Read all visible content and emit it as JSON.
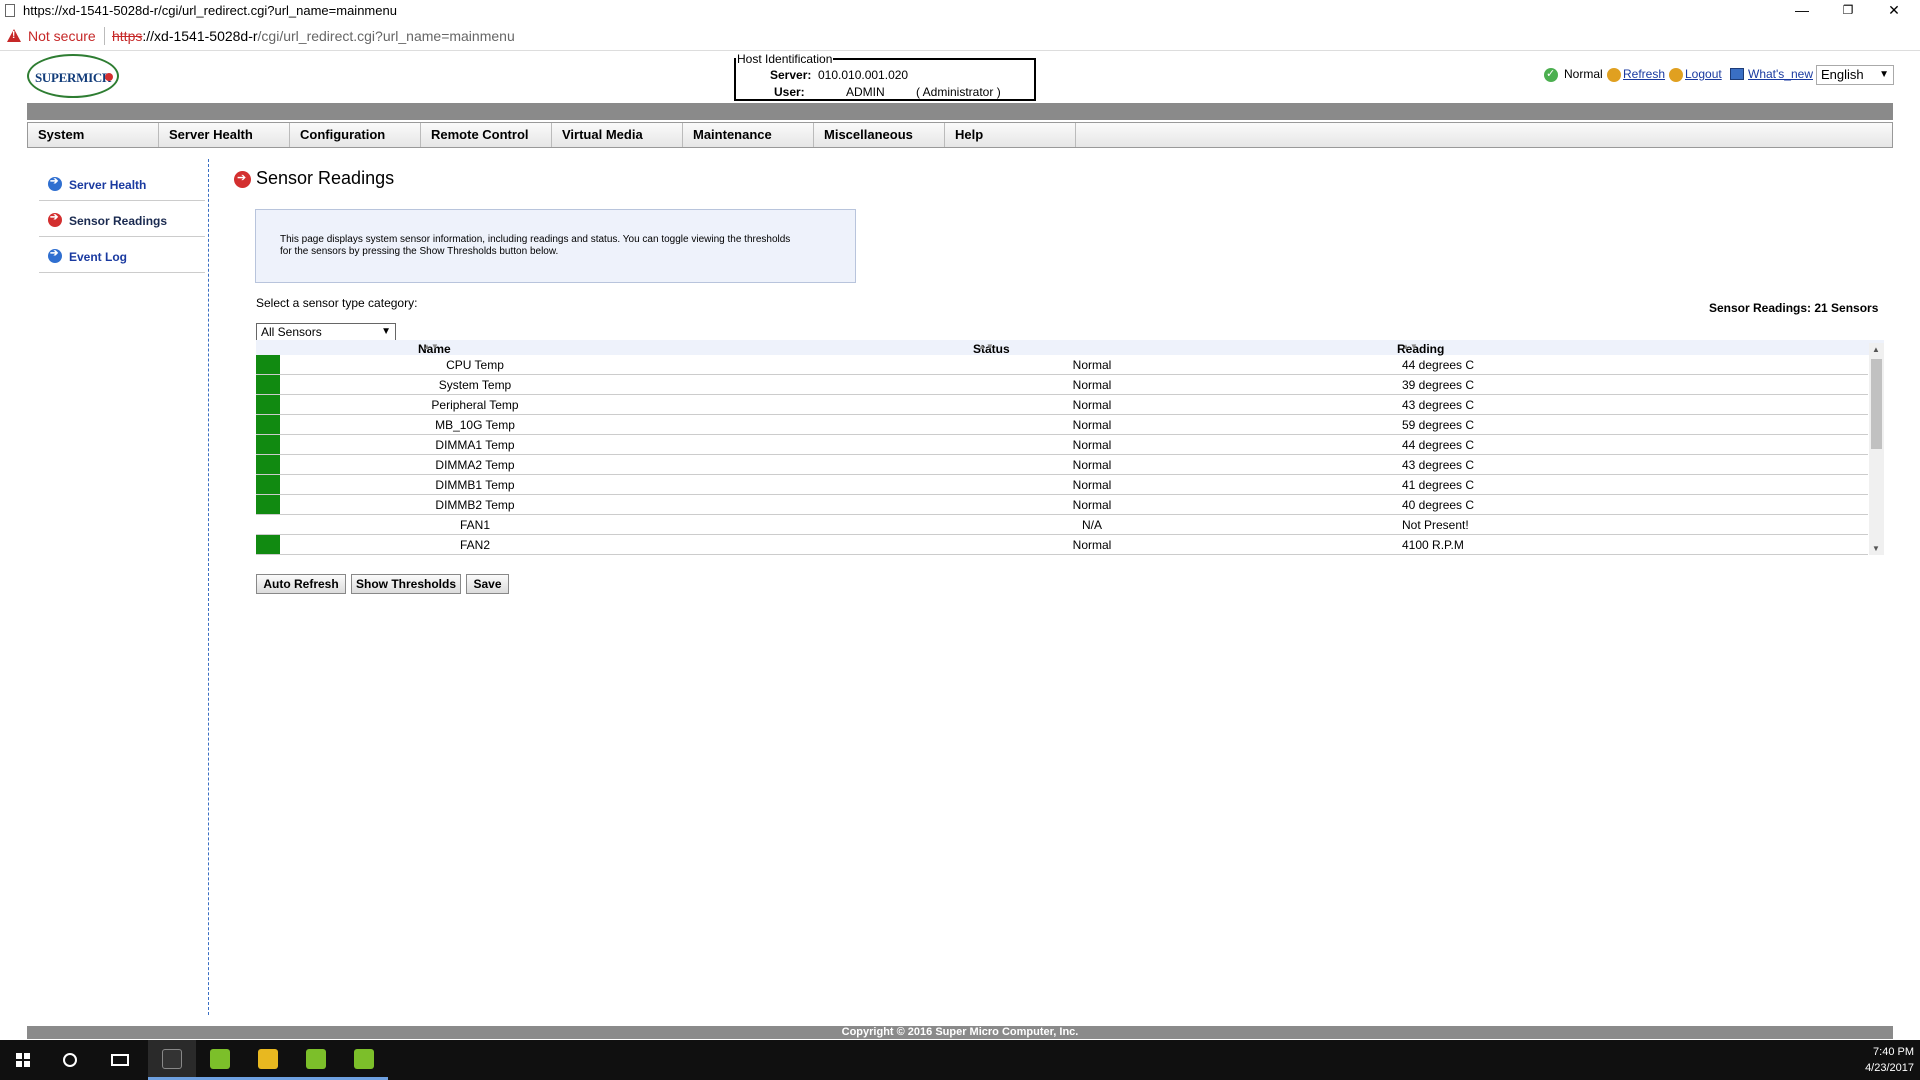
{
  "window": {
    "title_url": "https://xd-1541-5028d-r/cgi/url_redirect.cgi?url_name=mainmenu",
    "minimize": "—",
    "restore": "❐",
    "close": "✕"
  },
  "address_bar": {
    "security": "Not secure",
    "url_scheme": "https",
    "url_host": "://xd-1541-5028d-r",
    "url_path": "/cgi/url_redirect.cgi?url_name=mainmenu"
  },
  "header": {
    "logo_text": "SUPERMICR",
    "host_identification": {
      "legend": "Host Identification",
      "server_label": "Server:",
      "server_value": "010.010.001.020",
      "user_label": "User:",
      "user_value": "ADMIN",
      "role": "( Administrator )"
    },
    "status_label": "Normal",
    "refresh_label": "Refresh",
    "logout_label": "Logout",
    "whats_new_label": "What's_new",
    "language": "English"
  },
  "menu": [
    "System",
    "Server Health",
    "Configuration",
    "Remote Control",
    "Virtual Media",
    "Maintenance",
    "Miscellaneous",
    "Help"
  ],
  "sidebar": {
    "items": [
      {
        "label": "Server Health"
      },
      {
        "label": "Sensor Readings"
      },
      {
        "label": "Event Log"
      }
    ]
  },
  "main": {
    "title": "Sensor Readings",
    "info": "This page displays system sensor information, including readings and status. You can toggle viewing the thresholds for the sensors by pressing the Show Thresholds button below.",
    "category_label": "Select a sensor type category:",
    "category_value": "All Sensors",
    "sensor_count": "Sensor Readings: 21 Sensors",
    "columns": {
      "name": "Name",
      "status": "Status",
      "reading": "Reading"
    },
    "rows": [
      {
        "name": "CPU Temp",
        "status": "Normal",
        "reading": "44 degrees C",
        "indicator": "green"
      },
      {
        "name": "System Temp",
        "status": "Normal",
        "reading": "39 degrees C",
        "indicator": "green"
      },
      {
        "name": "Peripheral Temp",
        "status": "Normal",
        "reading": "43 degrees C",
        "indicator": "green"
      },
      {
        "name": "MB_10G Temp",
        "status": "Normal",
        "reading": "59 degrees C",
        "indicator": "green"
      },
      {
        "name": "DIMMA1 Temp",
        "status": "Normal",
        "reading": "44 degrees C",
        "indicator": "green"
      },
      {
        "name": "DIMMA2 Temp",
        "status": "Normal",
        "reading": "43 degrees C",
        "indicator": "green"
      },
      {
        "name": "DIMMB1 Temp",
        "status": "Normal",
        "reading": "41 degrees C",
        "indicator": "green"
      },
      {
        "name": "DIMMB2 Temp",
        "status": "Normal",
        "reading": "40 degrees C",
        "indicator": "green"
      },
      {
        "name": "FAN1",
        "status": "N/A",
        "reading": "Not Present!",
        "indicator": "none"
      },
      {
        "name": "FAN2",
        "status": "Normal",
        "reading": "4100 R.P.M",
        "indicator": "green"
      }
    ],
    "buttons": {
      "auto_refresh": "Auto Refresh",
      "show_thresholds": "Show Thresholds",
      "save": "Save"
    }
  },
  "footer": {
    "copyright": "Copyright © 2016 Super Micro Computer, Inc."
  },
  "taskbar": {
    "time": "7:40 PM",
    "date": "4/23/2017"
  },
  "colors": {
    "indicator_green": "#118a11",
    "accent_blue": "#1a3aa0",
    "alert_red": "#d32f2f"
  }
}
